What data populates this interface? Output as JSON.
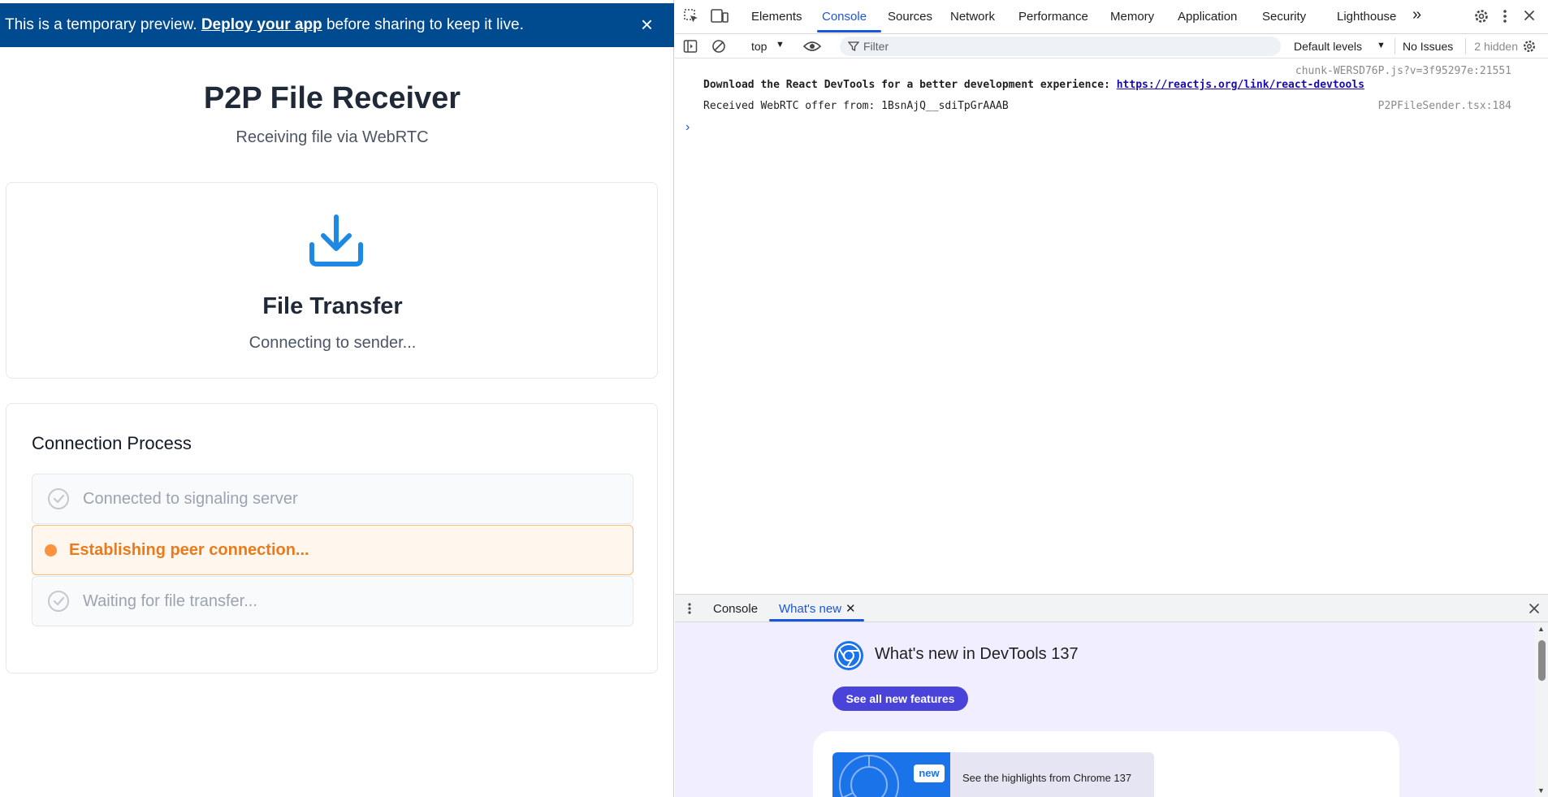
{
  "banner": {
    "text_before": "This is a temporary preview.",
    "link": "Deploy your app",
    "text_after": "before sharing to keep it live.",
    "close": "×"
  },
  "app": {
    "title": "P2P File Receiver",
    "subtitle": "Receiving file via WebRTC",
    "transfer_card": {
      "title": "File Transfer",
      "status": "Connecting to sender..."
    },
    "process": {
      "title": "Connection Process",
      "steps": [
        {
          "label": "Connected to signaling server",
          "state": "done"
        },
        {
          "label": "Establishing peer connection...",
          "state": "active"
        },
        {
          "label": "Waiting for file transfer...",
          "state": "pending"
        }
      ]
    },
    "colors": {
      "banner": "#004a8f",
      "accent": "#1e88e5",
      "active_step": "#ea7b1c"
    }
  },
  "devtools": {
    "tabs": [
      "Elements",
      "Console",
      "Sources",
      "Network",
      "Performance",
      "Memory",
      "Application",
      "Security",
      "Lighthouse"
    ],
    "active_tab": "Console",
    "overflow": "»",
    "toolbar": {
      "context": "top",
      "filter_placeholder": "Filter",
      "levels": "Default levels",
      "issues": "No Issues",
      "hidden": "2 hidden"
    },
    "console": {
      "messages": [
        {
          "source": "chunk-WERSD76P.js?v=3f95297e:21551",
          "text": "Download the React DevTools for a better development experience: ",
          "link": "https://reactjs.org/link/react-devtools"
        },
        {
          "source": "P2PFileSender.tsx:184",
          "text": "Received WebRTC offer from: 1BsnAjQ__sdiTpGrAAAB"
        }
      ],
      "prompt": "›"
    },
    "drawer": {
      "tabs": [
        "Console",
        "What's new"
      ],
      "active": "What's new",
      "whats_new": {
        "title": "What's new in DevTools 137",
        "button": "See all new features",
        "badge": "new",
        "highlight": "See the highlights from Chrome 137"
      }
    }
  }
}
